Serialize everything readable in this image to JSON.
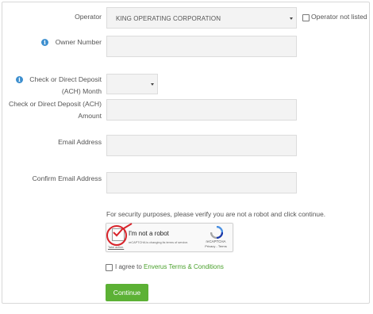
{
  "form": {
    "operator": {
      "label": "Operator",
      "selected": "KING OPERATING CORPORATION",
      "not_listed_label": "Operator not listed"
    },
    "owner_number": {
      "label": "Owner Number",
      "value": ""
    },
    "deposit_month": {
      "label_line1": "Check or Direct Deposit",
      "label_line2": "(ACH) Month",
      "selected": ""
    },
    "deposit_amount": {
      "label_line1": "Check or Direct Deposit (ACH)",
      "label_line2": "Amount",
      "value": ""
    },
    "email": {
      "label": "Email Address",
      "value": ""
    },
    "confirm_email": {
      "label": "Confirm Email Address",
      "value": ""
    },
    "security_note": "For security purposes, please verify you are not a robot and click continue.",
    "recaptcha": {
      "label": "I'm not a robot",
      "brand": "reCAPTCHA",
      "privacy": "Privacy",
      "terms": "Terms",
      "notice_line1": "reCAPTCHA is changing its terms of service.",
      "notice_line2": "Take action.",
      "checked": true
    },
    "agree": {
      "prefix": "I agree to ",
      "link_text": "Enverus Terms & Conditions",
      "checked": false
    },
    "continue_label": "Continue"
  },
  "icons": {
    "info": "info-icon",
    "dropdown": "caret-down-icon",
    "recaptcha": "recaptcha-logo-icon",
    "annotation": "red-circle-annotation"
  },
  "colors": {
    "accent_green": "#5cb135",
    "link_green": "#4aa02c",
    "info_blue": "#3d8fcf",
    "annotation_red": "#d8232a"
  }
}
